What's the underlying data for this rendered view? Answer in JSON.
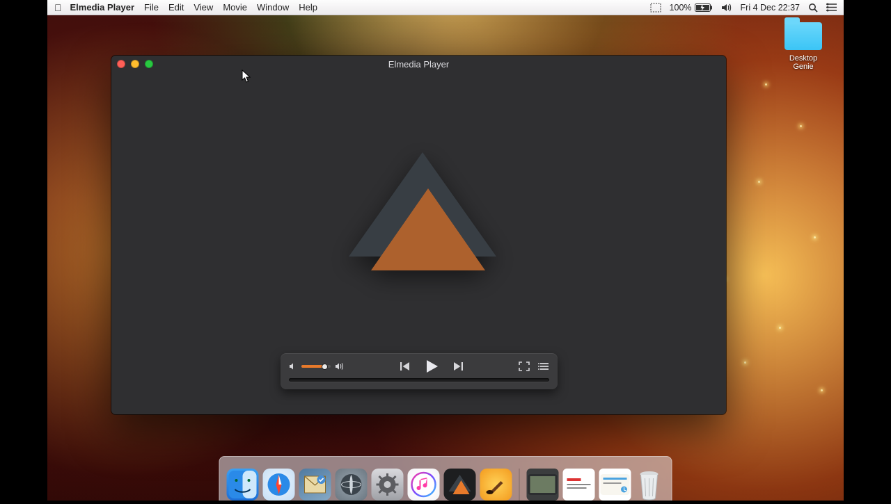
{
  "menubar": {
    "app_name": "Elmedia Player",
    "items": [
      "File",
      "Edit",
      "View",
      "Movie",
      "Window",
      "Help"
    ],
    "battery": "100%",
    "datetime": "Fri 4 Dec  22:37"
  },
  "desktop_icon": {
    "label": "Desktop Genie"
  },
  "window": {
    "title": "Elmedia Player"
  },
  "controls": {
    "volume_percent": 80,
    "icons": {
      "vol_low": "volume-low-icon",
      "vol_high": "volume-high-icon",
      "prev": "previous-icon",
      "play": "play-icon",
      "next": "next-icon",
      "fullscreen": "fullscreen-icon",
      "playlist": "playlist-icon"
    }
  },
  "dock": {
    "apps": [
      "finder",
      "safari",
      "mail",
      "launchpad",
      "system-preferences",
      "itunes",
      "elmedia",
      "garageband"
    ],
    "stacks": [
      "downloads-stack",
      "documents-stack",
      "desktop-stack"
    ],
    "trash": "trash"
  },
  "colors": {
    "accent": "#e87a2b",
    "window_bg": "#2f2f31"
  }
}
